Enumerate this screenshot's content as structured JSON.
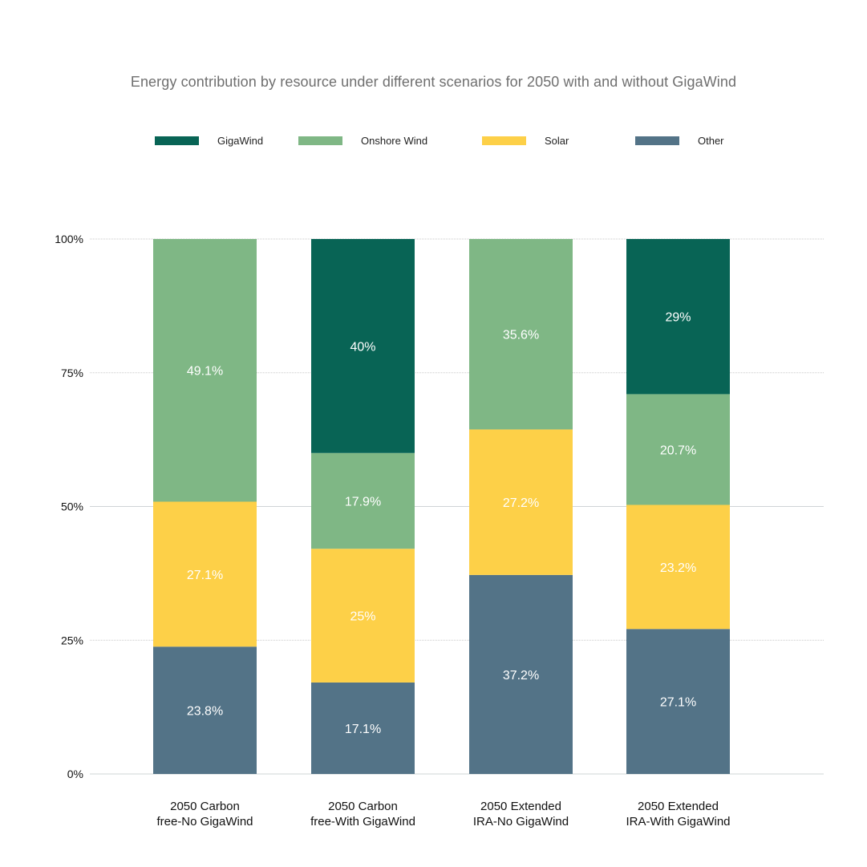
{
  "chart_data": {
    "type": "bar",
    "stacked": true,
    "title": "Energy contribution by resource under different scenarios for 2050 with and without GigaWind",
    "xlabel": "",
    "ylabel": "",
    "ylim": [
      0,
      100
    ],
    "y_ticks": [
      "0%",
      "25%",
      "50%",
      "75%",
      "100%"
    ],
    "y_tick_values": [
      0,
      25,
      50,
      75,
      100
    ],
    "grid": true,
    "legend_position": "top",
    "categories": [
      [
        "2050 Carbon",
        "free-No GigaWind"
      ],
      [
        "2050 Carbon",
        "free-With GigaWind"
      ],
      [
        "2050 Extended",
        "IRA-No GigaWind"
      ],
      [
        "2050 Extended",
        "IRA-With GigaWind"
      ]
    ],
    "series": [
      {
        "name": "Other",
        "color": "#537387",
        "values": [
          23.8,
          17.1,
          37.2,
          27.1
        ],
        "labels": [
          "23.8%",
          "17.1%",
          "37.2%",
          "27.1%"
        ]
      },
      {
        "name": "Solar",
        "color": "#fdd048",
        "values": [
          27.1,
          25,
          27.2,
          23.2
        ],
        "labels": [
          "27.1%",
          "25%",
          "27.2%",
          "23.2%"
        ]
      },
      {
        "name": "Onshore Wind",
        "color": "#7fb785",
        "values": [
          49.1,
          17.9,
          35.6,
          20.7
        ],
        "labels": [
          "49.1%",
          "17.9%",
          "35.6%",
          "20.7%"
        ]
      },
      {
        "name": "GigaWind",
        "color": "#086455",
        "values": [
          0,
          40,
          0,
          29
        ],
        "labels": [
          "",
          "40%",
          "",
          "29%"
        ]
      }
    ],
    "legend": [
      {
        "name": "GigaWind",
        "color": "#086455"
      },
      {
        "name": "Onshore Wind",
        "color": "#7fb785"
      },
      {
        "name": "Solar",
        "color": "#fdd048"
      },
      {
        "name": "Other",
        "color": "#537387"
      }
    ]
  }
}
